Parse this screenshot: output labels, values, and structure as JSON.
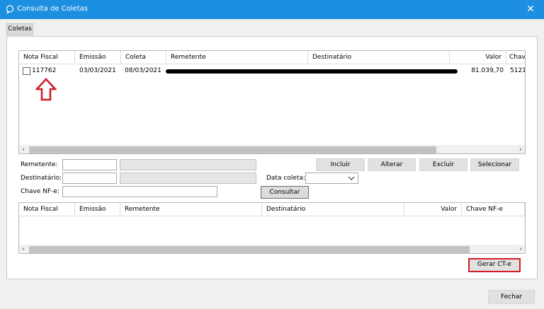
{
  "window": {
    "title": "Consulta de Coletas",
    "close_glyph": "✕"
  },
  "tab": {
    "label": "Coletas"
  },
  "grid1": {
    "headers": [
      "Nota Fiscal",
      "Emissão",
      "Coleta",
      "Remetente",
      "Destinatário",
      "Valor",
      "Chave"
    ],
    "rows": [
      {
        "nota": "117762",
        "emissao": "03/03/2021",
        "coleta": "08/03/2021",
        "remetente": "",
        "destinatario": "",
        "valor": "81.039,70",
        "chave": "5121"
      }
    ]
  },
  "form": {
    "remetente_label": "Remetente:",
    "destinatario_label": "Destinatário:",
    "chave_label": "Chave NF-e:",
    "data_coleta_label": "Data coleta:",
    "buttons": {
      "incluir": "Incluir",
      "alterar": "Alterar",
      "excluir": "Excluir",
      "selecionar": "Selecionar",
      "consultar": "Consultar"
    }
  },
  "grid2": {
    "headers": [
      "Nota Fiscal",
      "Emissão",
      "Remetente",
      "Destinatário",
      "Valor",
      "Chave NF-e"
    ]
  },
  "actions": {
    "gerar_cte": "Gerar CT-e",
    "fechar": "Fechar"
  },
  "colors": {
    "titlebar": "#1c8fe0",
    "highlight_red": "#d01d28"
  },
  "icons": {
    "window": "chat-bubble-icon",
    "annotation": "red-up-arrow-icon"
  }
}
